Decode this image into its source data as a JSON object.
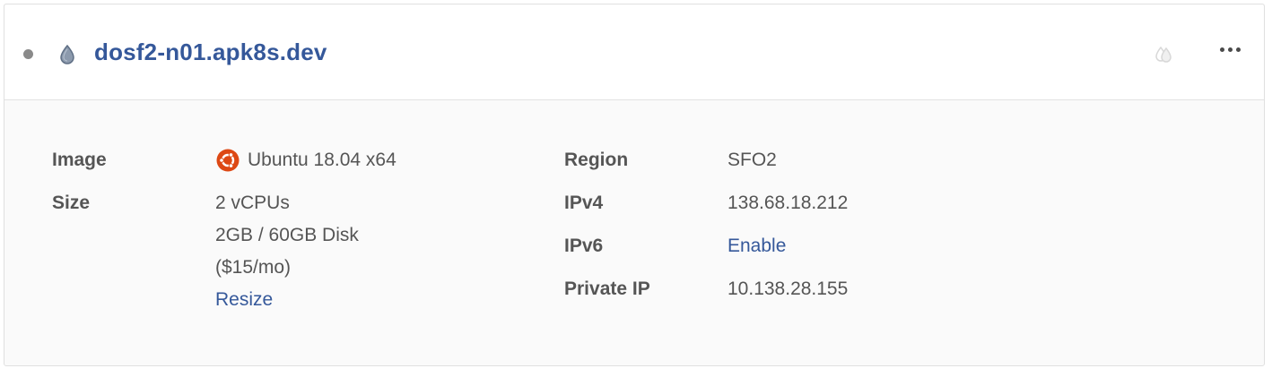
{
  "droplet": {
    "name": "dosf2-n01.apk8s.dev",
    "status_color": "#8a8a8a"
  },
  "icons": {
    "droplet": "droplet-icon",
    "backups": "backups-droplet-icon",
    "more": "more-options-icon",
    "image_os": "ubuntu-logo-icon"
  },
  "details": {
    "image": {
      "label": "Image",
      "value": "Ubuntu 18.04 x64"
    },
    "size": {
      "label": "Size",
      "vcpus": "2 vCPUs",
      "memory_disk": "2GB / 60GB Disk",
      "price": "($15/mo)",
      "resize_link": "Resize"
    },
    "region": {
      "label": "Region",
      "value": "SFO2"
    },
    "ipv4": {
      "label": "IPv4",
      "value": "138.68.18.212"
    },
    "ipv6": {
      "label": "IPv6",
      "enable_link": "Enable"
    },
    "private_ip": {
      "label": "Private IP",
      "value": "10.138.28.155"
    }
  },
  "colors": {
    "link": "#35589a",
    "ubuntu_orange": "#dd4814"
  }
}
